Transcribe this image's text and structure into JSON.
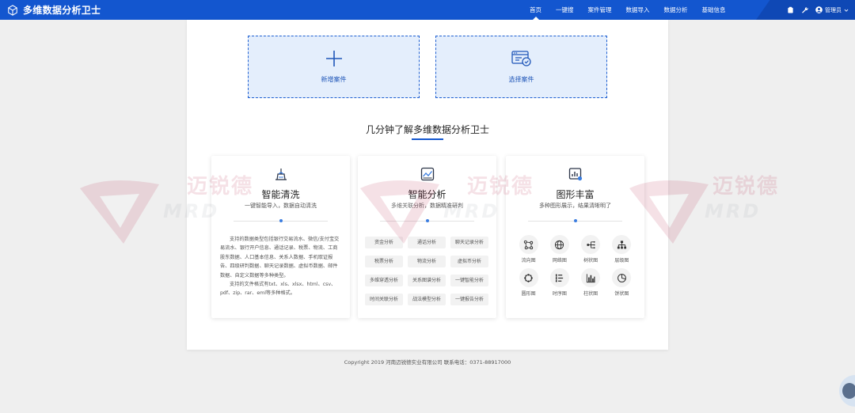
{
  "header": {
    "title": "多维数据分析卫士",
    "nav": [
      {
        "label": "首页",
        "active": true
      },
      {
        "label": "一键搜",
        "active": false
      },
      {
        "label": "案件管理",
        "active": false
      },
      {
        "label": "数据导入",
        "active": false
      },
      {
        "label": "数据分析",
        "active": false
      },
      {
        "label": "基础信息",
        "active": false
      }
    ],
    "user_label": "管理员"
  },
  "actions": {
    "new_case": "新增案件",
    "select_case": "选择案件"
  },
  "section_title": "几分钟了解多维数据分析卫士",
  "cards": {
    "cleaning": {
      "title": "智能清洗",
      "subtitle": "一键智能导入，数据自动清洗",
      "paragraphs": [
        "支持的数据类型包括银行交易流水、微信/支付宝交易流水、银行开户信息、通话记录、税票、物流、工商股东数据、人口基本信息、关系人数据、手机取证报告、四级研判数据、聊天记录数据、虚拟币数据、邮件数据、自定义数据等多种类型。",
        "支持的文件格式有txt、xls、xlsx、html、csv、pdf、zip、rar、eml等多种格式。"
      ]
    },
    "analysis": {
      "title": "智能分析",
      "subtitle": "多维关联分析，数据精准研判",
      "tags": [
        "资金分析",
        "通话分析",
        "聊天记录分析",
        "税票分析",
        "物流分析",
        "虚拟币分析",
        "多维穿透分析",
        "关系图谱分析",
        "一键智能分析",
        "时间关联分析",
        "战法模型分析",
        "一键报告分析"
      ]
    },
    "graphics": {
      "title": "图形丰富",
      "subtitle": "多种图形展示，结果清晰明了",
      "charts": [
        {
          "label": "流向图",
          "icon": "flow-chart-icon"
        },
        {
          "label": "网络图",
          "icon": "globe-icon"
        },
        {
          "label": "树状图",
          "icon": "tree-icon"
        },
        {
          "label": "层级图",
          "icon": "hierarchy-icon"
        },
        {
          "label": "圆形图",
          "icon": "circle-nodes-icon"
        },
        {
          "label": "时序图",
          "icon": "timeline-icon"
        },
        {
          "label": "柱状图",
          "icon": "bar-chart-icon"
        },
        {
          "label": "饼状图",
          "icon": "pie-chart-icon"
        }
      ]
    }
  },
  "footer": {
    "copyright": "Copyright 2019 河南迈锐德实业有限公司 联系电话：0371-88917000"
  },
  "watermark": {
    "cn": "迈锐德",
    "en": "MRD"
  },
  "colors": {
    "primary": "#1356cf",
    "action_bg": "#e4eefc",
    "page_bg": "#efefef"
  }
}
